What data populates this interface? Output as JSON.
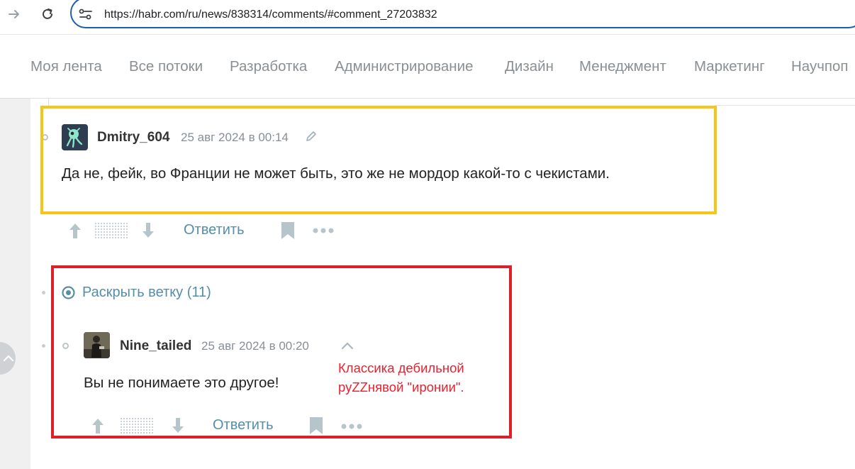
{
  "browser": {
    "url": "https://habr.com/ru/news/838314/comments/#comment_27203832"
  },
  "nav": {
    "items": [
      "Моя лента",
      "Все потоки",
      "Разработка",
      "Администрирование",
      "Дизайн",
      "Менеджмент",
      "Маркетинг",
      "Научпоп"
    ]
  },
  "comment1": {
    "username": "Dmitry_604",
    "timestamp": "25 авг 2024 в 00:14",
    "text": "Да не, фейк, во Франции не может быть, это же не мордор какой-то с чекистами.",
    "reply_label": "Ответить"
  },
  "thread": {
    "expand_label": "Раскрыть ветку (11)"
  },
  "comment2": {
    "username": "Nine_tailed",
    "timestamp": "25 авг 2024 в 00:20",
    "text": "Вы не понимаете это другое!",
    "reply_label": "Ответить"
  },
  "annotation": {
    "line1": "Классика дебильной",
    "line2": "руZZнявой \"иронии\"."
  },
  "colors": {
    "link": "#548eaa",
    "highlight_yellow": "#f5c518",
    "highlight_red": "#d9222a",
    "annotation_text": "#e8212f"
  }
}
